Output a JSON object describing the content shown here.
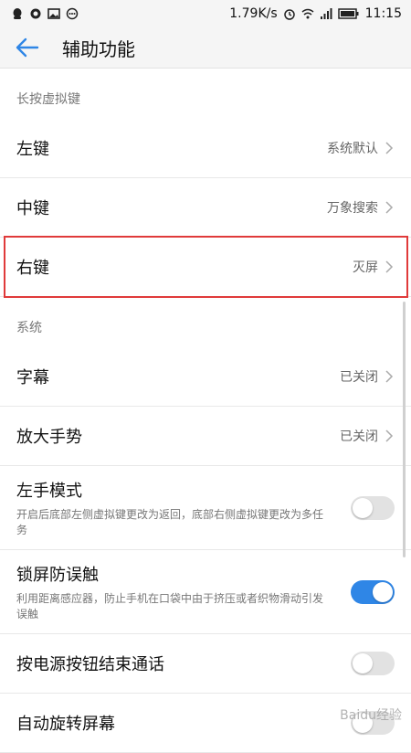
{
  "statusbar": {
    "speed": "1.79K/s",
    "time": "11:15"
  },
  "header": {
    "title": "辅助功能"
  },
  "sections": {
    "longpress": "长按虚拟键",
    "system": "系统"
  },
  "items": {
    "left_key": {
      "label": "左键",
      "value": "系统默认"
    },
    "middle_key": {
      "label": "中键",
      "value": "万象搜索"
    },
    "right_key": {
      "label": "右键",
      "value": "灭屏"
    },
    "subtitles": {
      "label": "字幕",
      "value": "已关闭"
    },
    "magnify": {
      "label": "放大手势",
      "value": "已关闭"
    },
    "left_hand": {
      "label": "左手模式",
      "desc": "开启后底部左侧虚拟键更改为返回，底部右侧虚拟键更改为多任务",
      "on": false
    },
    "lock_guard": {
      "label": "锁屏防误触",
      "desc": "利用距离感应器，防止手机在口袋中由于挤压或者织物滑动引发误触",
      "on": true
    },
    "power_end_call": {
      "label": "按电源按钮结束通话",
      "on": false
    },
    "auto_rotate": {
      "label": "自动旋转屏幕",
      "on": false
    }
  },
  "colors": {
    "accent": "#2f86e6",
    "highlight": "#e03a3a"
  },
  "watermark": "Baidu经验"
}
